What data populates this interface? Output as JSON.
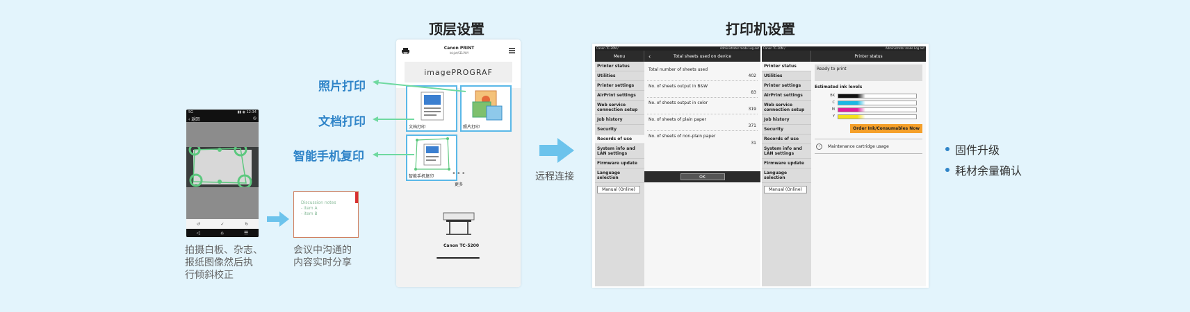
{
  "left": {
    "phone": {
      "status_left": "5G",
      "status_right": "▮▮ ◉ 12:34",
      "top_back": "‹ 返回",
      "top_right": "◎",
      "ctrl_left": "↺",
      "ctrl_mid": "✓",
      "ctrl_right": "↻",
      "nav_back": "◁",
      "nav_home": "⌂",
      "nav_menu": "☰"
    },
    "caption1": [
      "拍摄白板、杂志、",
      "报纸图像然后执",
      "行倾斜校正"
    ],
    "caption2": [
      "会议中沟通的",
      "内容实时分享"
    ],
    "paper_scribble": [
      "Discussion notes",
      "  - item A",
      "  - item B"
    ]
  },
  "middle": {
    "title": "顶层设置",
    "app": {
      "brand": "Canon PRINT",
      "brand_sub": "Inkjet/SELPHY",
      "banner": "imagePROGRAF",
      "tile_doc": "文档打印",
      "tile_photo": "照片打印",
      "tile_copy": "智能手机复印",
      "more": "更多",
      "printer_name": "Canon TC-5200"
    },
    "features": [
      "照片打印",
      "文档打印",
      "智能手机复印"
    ],
    "remote": "远程连接"
  },
  "right": {
    "title": "打印机设置",
    "top_left": "Canon TC-20M /",
    "top_right": "Administrator mode  Log out",
    "menu_label": "Menu",
    "menu_items": [
      "Printer status",
      "Utilities",
      "Printer settings",
      "AirPrint settings",
      "Web service connection setup",
      "Job history",
      "Security",
      "Records of use",
      "System info and LAN settings",
      "Firmware update",
      "Language selection"
    ],
    "manual_btn": "Manual (Online)",
    "pane1": {
      "header": "Total sheets used on device",
      "rows": [
        {
          "k": "Total number of sheets used",
          "v": "402"
        },
        {
          "k": "No. of sheets output in B&W",
          "v": "83"
        },
        {
          "k": "No. of sheets output in color",
          "v": "319"
        },
        {
          "k": "No. of sheets of plain paper",
          "v": "371"
        },
        {
          "k": "No. of sheets of non-plain paper",
          "v": "31"
        }
      ],
      "ok": "OK"
    },
    "pane2": {
      "header": "Printer status",
      "ready": "Ready to print",
      "ink_title": "Estimated ink levels",
      "inks": [
        {
          "name": "BK",
          "color": "#111111",
          "level": 0.35
        },
        {
          "name": "C",
          "color": "#19b8e6",
          "level": 0.35
        },
        {
          "name": "M",
          "color": "#e01e9b",
          "level": 0.35
        },
        {
          "name": "Y",
          "color": "#f5e21a",
          "level": 0.35
        }
      ],
      "order_btn": "Order Ink/Consumables Now",
      "maint": "Maintenance cartridge usage"
    },
    "bullets": [
      "固件升级",
      "耗材余量确认"
    ]
  },
  "colors": {
    "accent_blue": "#2f84c8",
    "arrow_blue": "#6cc3ec",
    "green_line": "#6fd9a0",
    "order_orange": "#f5a02a"
  }
}
